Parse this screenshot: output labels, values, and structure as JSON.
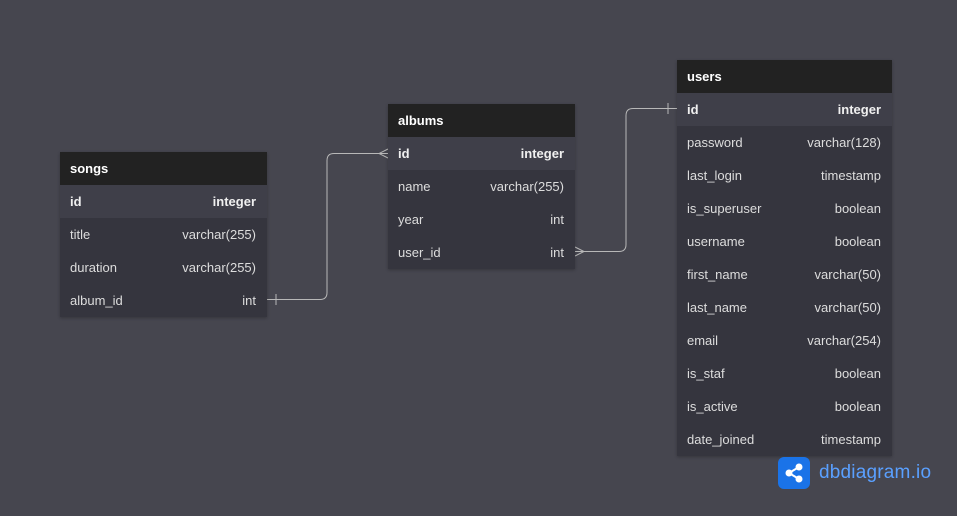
{
  "tables": {
    "songs": {
      "name": "songs",
      "fields": [
        {
          "name": "id",
          "type": "integer"
        },
        {
          "name": "title",
          "type": "varchar(255)"
        },
        {
          "name": "duration",
          "type": "varchar(255)"
        },
        {
          "name": "album_id",
          "type": "int"
        }
      ]
    },
    "albums": {
      "name": "albums",
      "fields": [
        {
          "name": "id",
          "type": "integer"
        },
        {
          "name": "name",
          "type": "varchar(255)"
        },
        {
          "name": "year",
          "type": "int"
        },
        {
          "name": "user_id",
          "type": "int"
        }
      ]
    },
    "users": {
      "name": "users",
      "fields": [
        {
          "name": "id",
          "type": "integer"
        },
        {
          "name": "password",
          "type": "varchar(128)"
        },
        {
          "name": "last_login",
          "type": "timestamp"
        },
        {
          "name": "is_superuser",
          "type": "boolean"
        },
        {
          "name": "username",
          "type": "boolean"
        },
        {
          "name": "first_name",
          "type": "varchar(50)"
        },
        {
          "name": "last_name",
          "type": "varchar(50)"
        },
        {
          "name": "email",
          "type": "varchar(254)"
        },
        {
          "name": "is_staf",
          "type": "boolean"
        },
        {
          "name": "is_active",
          "type": "boolean"
        },
        {
          "name": "date_joined",
          "type": "timestamp"
        }
      ]
    }
  },
  "relationships": [
    {
      "from": "songs.album_id",
      "to": "albums.id",
      "from_end": "one",
      "to_end": "many"
    },
    {
      "from": "albums.user_id",
      "to": "users.id",
      "from_end": "many",
      "to_end": "one"
    }
  ],
  "brand": {
    "text": "dbdiagram.io",
    "icon": "share-nodes-icon",
    "logo_color": "#1a73e8",
    "text_color": "#5aa0ff"
  },
  "colors": {
    "canvas": "#46464f",
    "table_header": "#222222",
    "table_body": "#35353e",
    "primary_key_row": "#3f3f49",
    "connector": "#b8b8b8"
  }
}
